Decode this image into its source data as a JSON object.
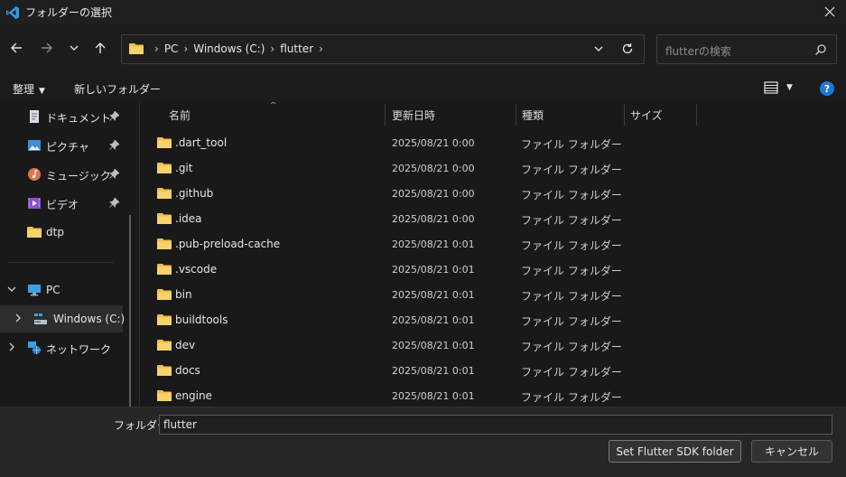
{
  "window": {
    "title": "フォルダーの選択",
    "accent": "#1e7ad6"
  },
  "nav": {
    "breadcrumb": [
      "PC",
      "Windows (C:)",
      "flutter"
    ],
    "search_placeholder": "flutterの検索"
  },
  "commands": {
    "organize": "整理",
    "new_folder": "新しいフォルダー"
  },
  "sidebar": {
    "quick": [
      {
        "label": "ドキュメント",
        "icon": "documents-icon",
        "pinned": true
      },
      {
        "label": "ピクチャ",
        "icon": "pictures-icon",
        "pinned": true
      },
      {
        "label": "ミュージック",
        "icon": "music-icon",
        "pinned": true
      },
      {
        "label": "ビデオ",
        "icon": "videos-icon",
        "pinned": true
      },
      {
        "label": "dtp",
        "icon": "folder-icon",
        "pinned": false
      }
    ],
    "pc": "PC",
    "drive": "Windows (C:)",
    "network": "ネットワーク"
  },
  "list": {
    "columns": {
      "name": "名前",
      "modified": "更新日時",
      "type": "種類",
      "size": "サイズ"
    },
    "rows": [
      {
        "name": ".dart_tool",
        "modified": "2025/08/21 0:00",
        "type": "ファイル フォルダー"
      },
      {
        "name": ".git",
        "modified": "2025/08/21 0:00",
        "type": "ファイル フォルダー"
      },
      {
        "name": ".github",
        "modified": "2025/08/21 0:00",
        "type": "ファイル フォルダー"
      },
      {
        "name": ".idea",
        "modified": "2025/08/21 0:00",
        "type": "ファイル フォルダー"
      },
      {
        "name": ".pub-preload-cache",
        "modified": "2025/08/21 0:01",
        "type": "ファイル フォルダー"
      },
      {
        "name": ".vscode",
        "modified": "2025/08/21 0:01",
        "type": "ファイル フォルダー"
      },
      {
        "name": "bin",
        "modified": "2025/08/21 0:01",
        "type": "ファイル フォルダー"
      },
      {
        "name": "buildtools",
        "modified": "2025/08/21 0:01",
        "type": "ファイル フォルダー"
      },
      {
        "name": "dev",
        "modified": "2025/08/21 0:01",
        "type": "ファイル フォルダー"
      },
      {
        "name": "docs",
        "modified": "2025/08/21 0:01",
        "type": "ファイル フォルダー"
      },
      {
        "name": "engine",
        "modified": "2025/08/21 0:01",
        "type": "ファイル フォルダー"
      }
    ]
  },
  "footer": {
    "folder_label": "フォルダー:",
    "folder_value": "flutter",
    "select_button": "Set Flutter SDK folder",
    "cancel_button": "キャンセル"
  }
}
